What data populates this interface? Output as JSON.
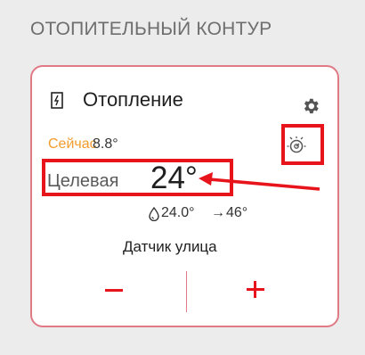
{
  "section": {
    "title": "ОТОПИТЕЛЬНЫЙ КОНТУР"
  },
  "circuit": {
    "name": "Отопление",
    "now_label": "Сейчас",
    "now_value": "8.8°",
    "target_label": "Целевая",
    "target_value": "24°",
    "boiler_temp": "24.0°",
    "arrow_glyph": "→",
    "supply_temp": "46°",
    "sensor_label": "Датчик улица"
  },
  "icons": [
    "heater-icon",
    "gear-icon",
    "boiler-icon",
    "drop-icon",
    "arrow-right-icon",
    "minus-icon",
    "plus-icon"
  ],
  "colors": {
    "accent_red": "#e8141c",
    "card_border": "#e07a84",
    "now_label": "#f39c2c",
    "background": "#ececec",
    "card_bg": "#ffffff"
  }
}
